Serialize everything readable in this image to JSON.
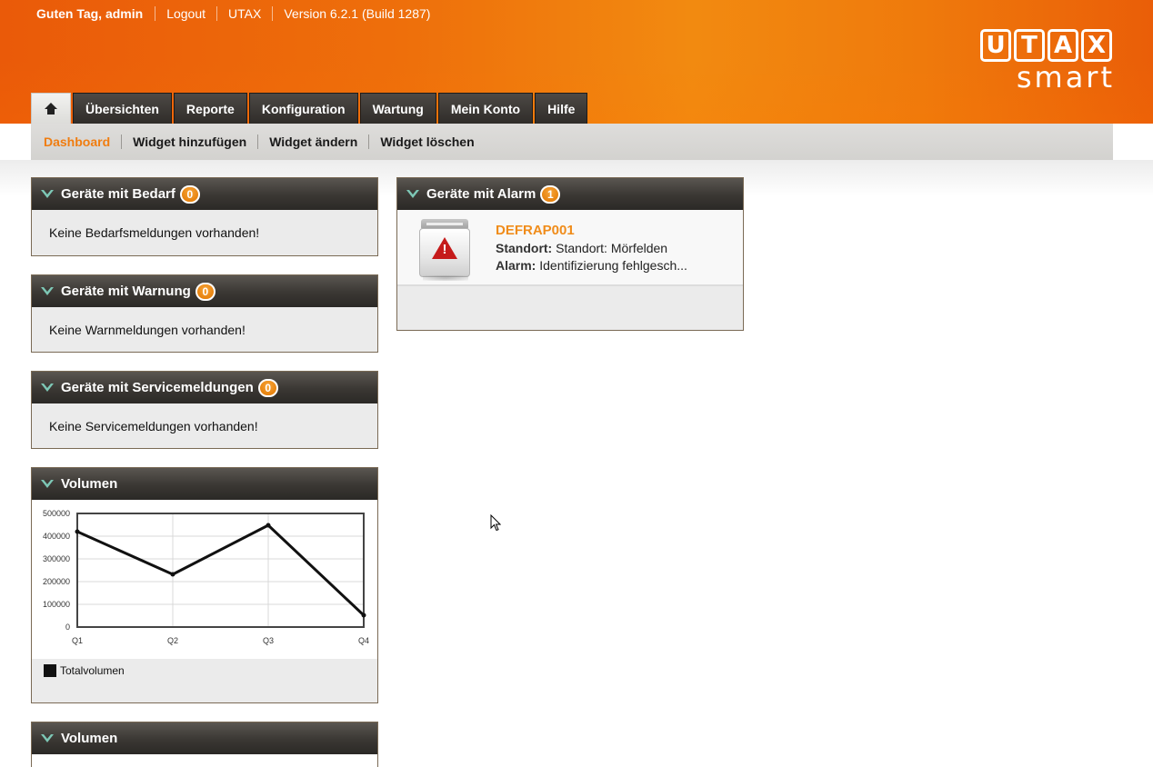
{
  "topbar": {
    "greeting": "Guten Tag, admin",
    "logout": "Logout",
    "brand": "UTAX",
    "version": "Version 6.2.1 (Build 1287)"
  },
  "logo": {
    "letters": [
      "U",
      "T",
      "A",
      "X"
    ],
    "sub": "smart"
  },
  "tabs": [
    {
      "label": "Übersichten"
    },
    {
      "label": "Reporte"
    },
    {
      "label": "Konfiguration"
    },
    {
      "label": "Wartung"
    },
    {
      "label": "Mein Konto"
    },
    {
      "label": "Hilfe"
    }
  ],
  "subnav": [
    {
      "label": "Dashboard"
    },
    {
      "label": "Widget hinzufügen"
    },
    {
      "label": "Widget ändern"
    },
    {
      "label": "Widget löschen"
    }
  ],
  "widgets": {
    "bedarf": {
      "title": "Geräte mit Bedarf",
      "count": "0",
      "message": "Keine Bedarfsmeldungen vorhanden!"
    },
    "warnung": {
      "title": "Geräte mit Warnung",
      "count": "0",
      "message": "Keine Warnmeldungen vorhanden!"
    },
    "service": {
      "title": "Geräte mit Servicemeldungen",
      "count": "0",
      "message": "Keine Servicemeldungen vorhanden!"
    },
    "alarm": {
      "title": "Geräte mit Alarm",
      "count": "1",
      "device": "DEFRAP001",
      "location_label": "Standort:",
      "location_value": "Standort: Mörfelden",
      "alarm_label": "Alarm:",
      "alarm_value": "Identifizierung fehlgesch..."
    },
    "volumen1": {
      "title": "Volumen",
      "legend": "Totalvolumen"
    },
    "volumen2": {
      "title": "Volumen"
    }
  },
  "chart_data": {
    "type": "line",
    "categories": [
      "Q1",
      "Q2",
      "Q3",
      "Q4"
    ],
    "series": [
      {
        "name": "Totalvolumen",
        "values": [
          420000,
          232000,
          448000,
          52000
        ]
      }
    ],
    "yticks": [
      0,
      100000,
      200000,
      300000,
      400000,
      500000
    ],
    "ylim": [
      0,
      500000
    ],
    "grid": true,
    "legend": "bottom-left"
  },
  "colors": {
    "accent": "#f07d10",
    "header": "#ee6f0b",
    "alarm_red": "#c51a1a"
  },
  "icons": {
    "home": "home-icon",
    "collapse": "chevron-down-icon",
    "alarm": "warning-icon"
  }
}
